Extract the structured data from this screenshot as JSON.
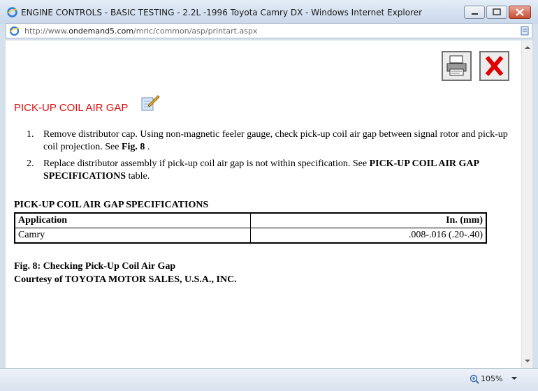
{
  "window": {
    "title": "ENGINE CONTROLS - BASIC TESTING - 2.2L -1996 Toyota Camry DX - Windows Internet Explorer",
    "address_prefix": "http://www.",
    "address_domain": "ondemand5.com",
    "address_path": "/mric/common/asp/printart.aspx"
  },
  "status": {
    "zoom": "105%"
  },
  "page": {
    "heading": "PICK-UP COIL AIR GAP",
    "steps": [
      {
        "num": "1.",
        "text_before": "Remove distributor cap. Using non-magnetic feeler gauge, check pick-up coil air gap between signal rotor and pick-up coil projection. See ",
        "bold": "Fig. 8",
        "text_after": " ."
      },
      {
        "num": "2.",
        "text_before": "Replace distributor assembly if pick-up coil air gap is not within specification. See ",
        "bold": "PICK-UP COIL AIR GAP SPECIFICATIONS",
        "text_after": " table."
      }
    ],
    "spec_title": "PICK-UP COIL AIR GAP SPECIFICATIONS",
    "table": {
      "headers": [
        "Application",
        "In. (mm)"
      ],
      "rows": [
        [
          "Camry",
          ".008-.016 (.20-.40)"
        ]
      ]
    },
    "caption_line1": "Fig. 8: Checking Pick-Up Coil Air Gap",
    "caption_line2": "Courtesy of TOYOTA MOTOR SALES, U.S.A., INC."
  },
  "icons": {
    "browser": "ie-icon",
    "print": "printer-icon",
    "close": "red-x-icon",
    "edit": "pencil-notepad-icon",
    "zoom": "magnifier-icon"
  },
  "colors": {
    "heading": "#e01010",
    "close_x": "#e00000"
  }
}
